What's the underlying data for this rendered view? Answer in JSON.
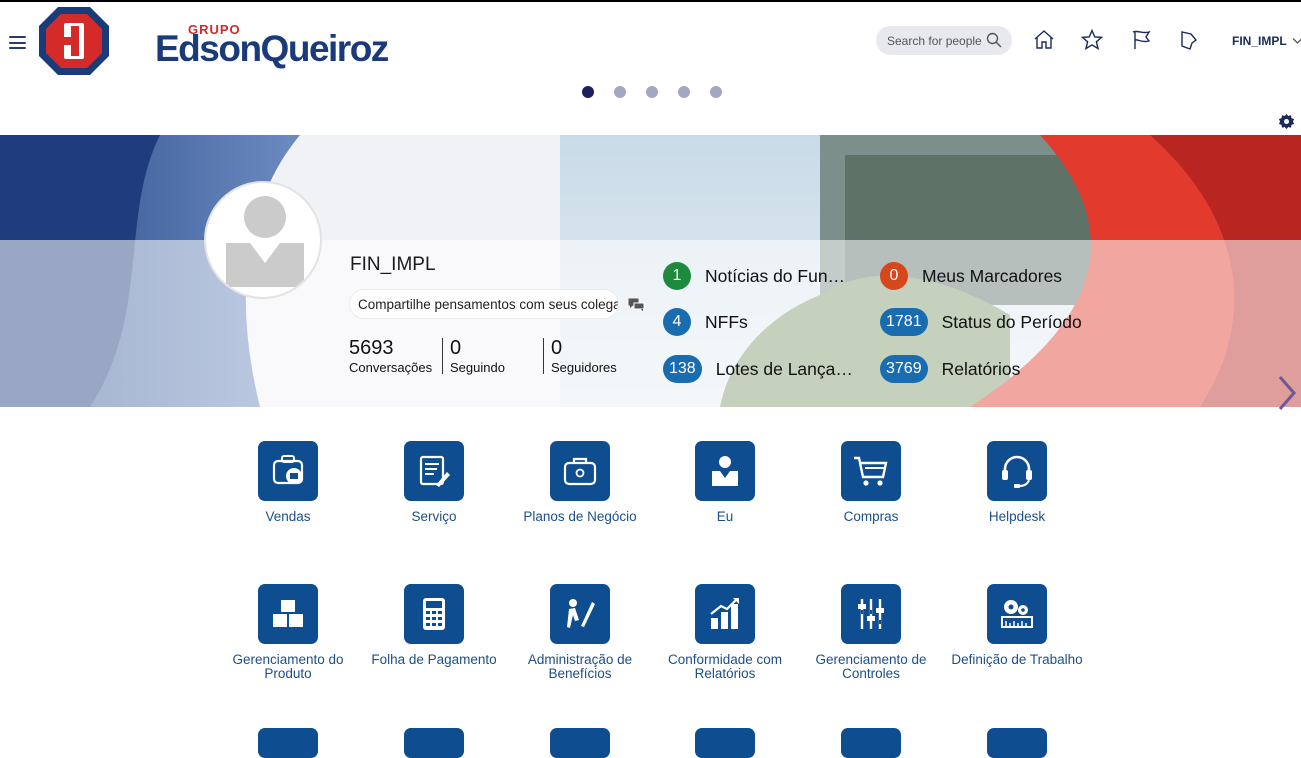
{
  "header": {
    "logo_small": "GRUPO",
    "logo_text": "EdsonQueiroz",
    "search_placeholder": "Search for people",
    "user": "FIN_IMPL",
    "icons": [
      "home-icon",
      "star-icon",
      "flag-icon",
      "bell-icon"
    ]
  },
  "carousel": {
    "count": 5,
    "active": 0
  },
  "profile": {
    "name": "FIN_IMPL",
    "share_placeholder": "Compartilhe pensamentos com seus colegas",
    "stats": [
      {
        "value": "5693",
        "label": "Conversações"
      },
      {
        "value": "0",
        "label": "Seguindo"
      },
      {
        "value": "0",
        "label": "Seguidores"
      }
    ]
  },
  "notifications": [
    {
      "count": "1",
      "label": "Notícias do Fun…",
      "color": "#1e8a3e"
    },
    {
      "count": "0",
      "label": "Meus Marcadores",
      "color": "#d6471c"
    },
    {
      "count": "4",
      "label": "NFFs",
      "color": "#1a6cb0"
    },
    {
      "count": "1781",
      "label": "Status do Período",
      "color": "#1a6cb0"
    },
    {
      "count": "138",
      "label": "Lotes de Lança…",
      "color": "#1a6cb0"
    },
    {
      "count": "3769",
      "label": "Relatórios",
      "color": "#1a6cb0"
    }
  ],
  "apps": [
    {
      "label": "Vendas",
      "icon": "sales-icon"
    },
    {
      "label": "Serviço",
      "icon": "service-icon"
    },
    {
      "label": "Planos de Negócio",
      "icon": "briefcase-icon"
    },
    {
      "label": "Eu",
      "icon": "person-icon"
    },
    {
      "label": "Compras",
      "icon": "cart-icon"
    },
    {
      "label": "Helpdesk",
      "icon": "headset-icon"
    },
    {
      "label": "Gerenciamento do Produto",
      "icon": "boxes-icon"
    },
    {
      "label": "Folha de Pagamento",
      "icon": "calculator-icon"
    },
    {
      "label": "Administração de Benefícios",
      "icon": "benefits-icon"
    },
    {
      "label": "Conformidade com Relatórios",
      "icon": "bar-chart-icon"
    },
    {
      "label": "Gerenciamento de Controles",
      "icon": "sliders-icon"
    },
    {
      "label": "Definição de Trabalho",
      "icon": "gears-icon"
    }
  ]
}
